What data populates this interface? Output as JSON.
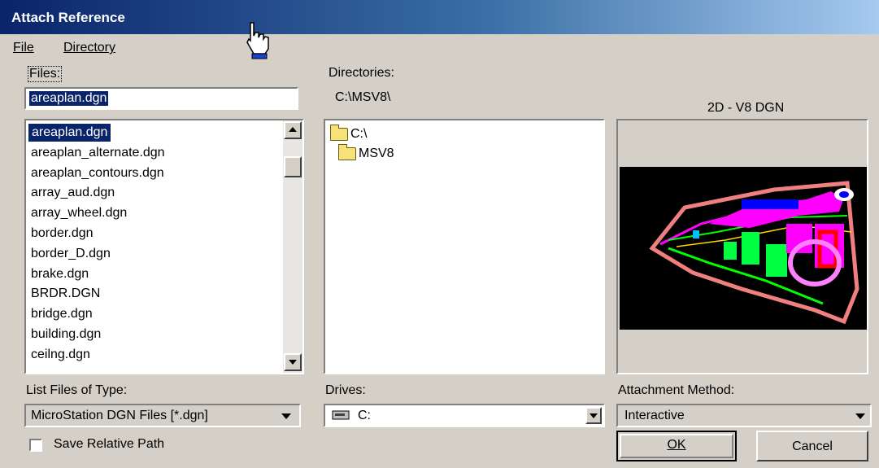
{
  "window": {
    "title": "Attach Reference"
  },
  "menu": {
    "file": "File",
    "directory": "Directory"
  },
  "files": {
    "label": "Files:",
    "filename_value": "areaplan.dgn",
    "list": [
      "areaplan.dgn",
      "areaplan_alternate.dgn",
      "areaplan_contours.dgn",
      "array_aud.dgn",
      "array_wheel.dgn",
      "border.dgn",
      "border_D.dgn",
      "brake.dgn",
      "BRDR.DGN",
      "bridge.dgn",
      "building.dgn",
      "ceilng.dgn"
    ],
    "selected_index": 0
  },
  "directories": {
    "label": "Directories:",
    "current_path": "C:\\MSV8\\",
    "tree": [
      "C:\\",
      "MSV8"
    ]
  },
  "preview": {
    "label": "2D - V8 DGN"
  },
  "file_type": {
    "label": "List Files of Type:",
    "value": "MicroStation DGN Files [*.dgn]"
  },
  "drives": {
    "label": "Drives:",
    "value": "C:"
  },
  "attachment": {
    "label": "Attachment Method:",
    "value": "Interactive"
  },
  "save_relative": {
    "label": "Save Relative Path",
    "checked": false
  },
  "buttons": {
    "ok": "OK",
    "cancel": "Cancel"
  },
  "colors": {
    "titlebar": "#0a246a",
    "selection": "#0a246a",
    "dialog_bg": "#d4d0c8"
  }
}
